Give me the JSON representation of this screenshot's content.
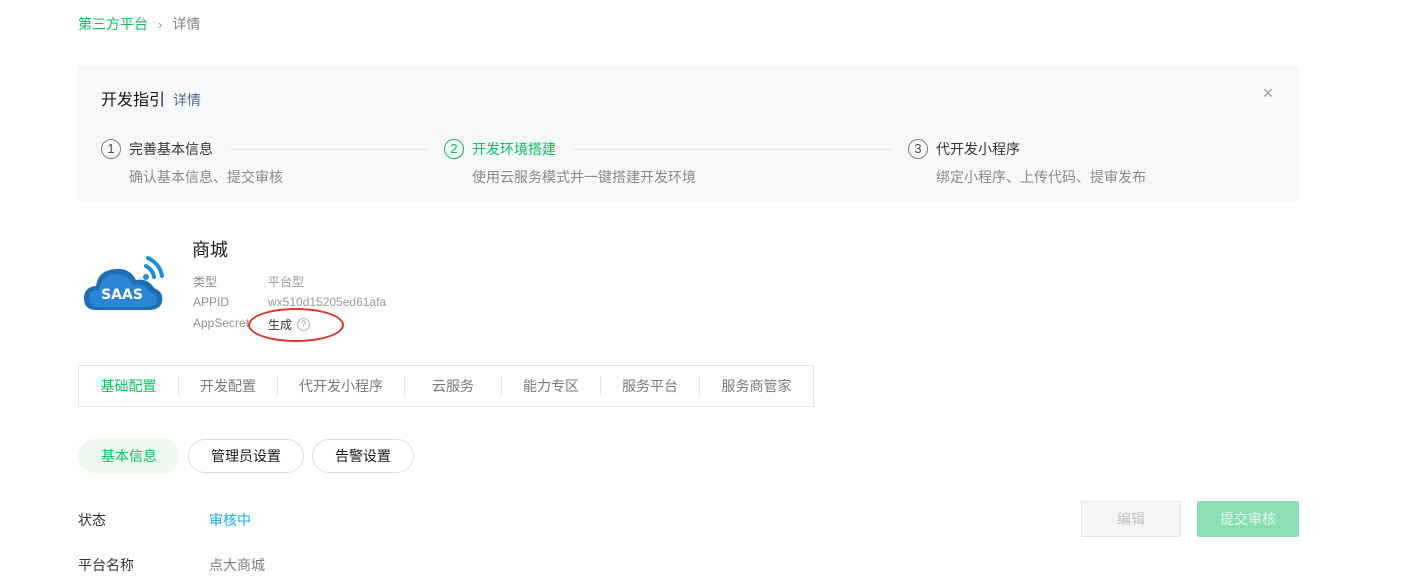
{
  "breadcrumb": {
    "parent": "第三方平台",
    "separator": "›",
    "current": "详情"
  },
  "guide": {
    "title": "开发指引",
    "detail_link": "详情",
    "close_glyph": "×",
    "steps": [
      {
        "num": "1",
        "title": "完善基本信息",
        "desc": "确认基本信息、提交审核",
        "active": false
      },
      {
        "num": "2",
        "title": "开发环境搭建",
        "desc": "使用云服务模式并一键搭建开发环境",
        "active": true
      },
      {
        "num": "3",
        "title": "代开发小程序",
        "desc": "绑定小程序、上传代码、提审发布",
        "active": false
      }
    ]
  },
  "app": {
    "logo_text": "SAAS",
    "name": "商城",
    "type_label": "类型",
    "type_value": "平台型",
    "appid_label": "APPID",
    "appid_value": "wx510d15205ed61afa",
    "secret_label": "AppSecret",
    "secret_value": "生成",
    "help_glyph": "?"
  },
  "tabs": {
    "items": [
      {
        "label": "基础配置",
        "active": true
      },
      {
        "label": "开发配置",
        "active": false
      },
      {
        "label": "代开发小程序",
        "active": false
      },
      {
        "label": "云服务",
        "active": false
      },
      {
        "label": "能力专区",
        "active": false
      },
      {
        "label": "服务平台",
        "active": false
      },
      {
        "label": "服务商管家",
        "active": false
      }
    ]
  },
  "subtabs": {
    "items": [
      {
        "label": "基本信息",
        "active": true
      },
      {
        "label": "管理员设置",
        "active": false
      },
      {
        "label": "告警设置",
        "active": false
      }
    ]
  },
  "info": {
    "status_label": "状态",
    "status_value": "审核中",
    "platform_name_label": "平台名称",
    "platform_name_value": "点大商城"
  },
  "actions": {
    "edit_label": "编辑",
    "submit_label": "提交审核"
  },
  "colors": {
    "accent": "#07c160",
    "link": "#576b95",
    "status": "#10aeff",
    "annotation": "#d9342b"
  }
}
